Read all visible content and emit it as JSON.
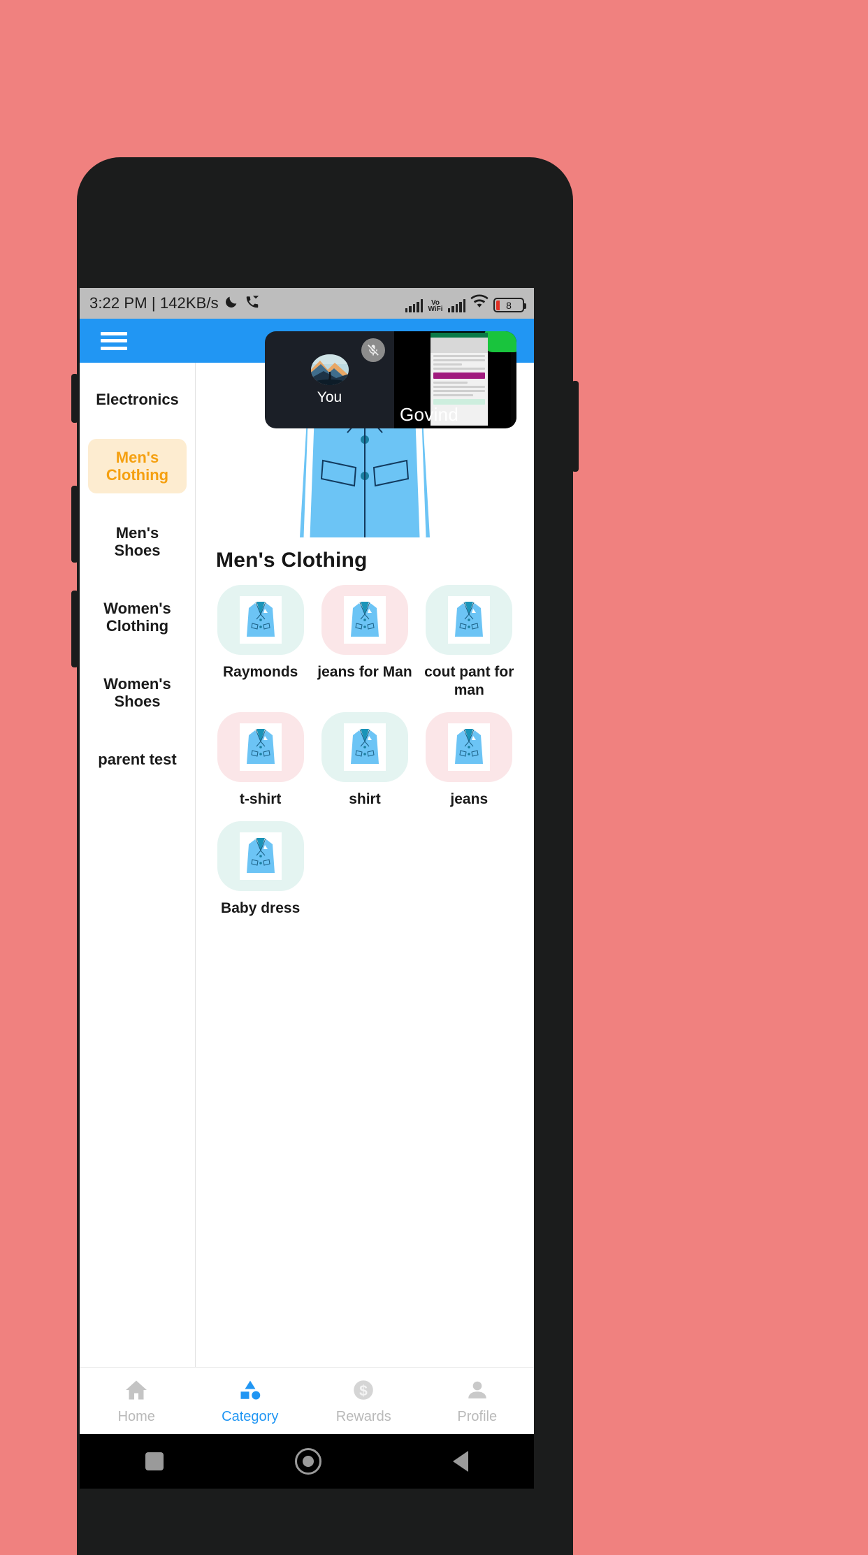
{
  "background_color": "#F0817F",
  "status_bar": {
    "time_and_data": "3:22 PM | 142KB/s",
    "icons": [
      "moon-icon",
      "wifi-calling-icon",
      "signal-bars-icon",
      "vo-wifi-icon",
      "signal-bars-2-icon",
      "wifi-icon",
      "battery-icon"
    ],
    "vo_label_top": "Vo",
    "vo_label_bottom": "WiFi",
    "battery_level": "8"
  },
  "app_bar": {
    "menu_icon": "hamburger-menu-icon",
    "background_color": "#2196F3"
  },
  "sidebar": {
    "items": [
      {
        "label": "Electronics",
        "selected": false
      },
      {
        "label": "Men's Clothing",
        "selected": true
      },
      {
        "label": "Men's Shoes",
        "selected": false
      },
      {
        "label": "Women's Clothing",
        "selected": false
      },
      {
        "label": "Women's Shoes",
        "selected": false
      },
      {
        "label": "parent test",
        "selected": false
      }
    ],
    "selected_bg": "#fdecd0",
    "selected_color": "#f5a011"
  },
  "main": {
    "hero_image": "blue-suit-jacket-banner",
    "section_title": "Men's Clothing",
    "products": [
      {
        "label": "Raymonds",
        "thumb_bg": "#e4f4f1",
        "icon": "blue-blazer-icon"
      },
      {
        "label": "jeans for Man",
        "thumb_bg": "#fbe6e8",
        "icon": "blue-blazer-icon"
      },
      {
        "label": "cout pant for man",
        "thumb_bg": "#e4f4f1",
        "icon": "blue-blazer-icon"
      },
      {
        "label": "t-shirt",
        "thumb_bg": "#fbe6e8",
        "icon": "blue-blazer-icon"
      },
      {
        "label": "shirt",
        "thumb_bg": "#e4f4f1",
        "icon": "blue-blazer-icon"
      },
      {
        "label": "jeans",
        "thumb_bg": "#fbe6e8",
        "icon": "blue-blazer-icon"
      },
      {
        "label": "Baby dress",
        "thumb_bg": "#e4f4f1",
        "icon": "blue-blazer-icon"
      }
    ]
  },
  "call_overlay": {
    "self_label": "You",
    "self_avatar": "mountain-hiker-avatar",
    "mic_state_icon": "microphone-muted-icon",
    "remote_label": "Govind",
    "remote_content": "shared-screen-checkout"
  },
  "bottom_nav": {
    "items": [
      {
        "label": "Home",
        "icon": "home-icon",
        "active": false
      },
      {
        "label": "Category",
        "icon": "shapes-category-icon",
        "active": true
      },
      {
        "label": "Rewards",
        "icon": "dollar-coin-icon",
        "active": false
      },
      {
        "label": "Profile",
        "icon": "person-icon",
        "active": false
      }
    ],
    "active_color": "#2196F3",
    "inactive_color": "#b9b9b9"
  },
  "android_nav": {
    "recents": "square-recents-icon",
    "home": "circle-home-icon",
    "back": "triangle-back-icon"
  }
}
